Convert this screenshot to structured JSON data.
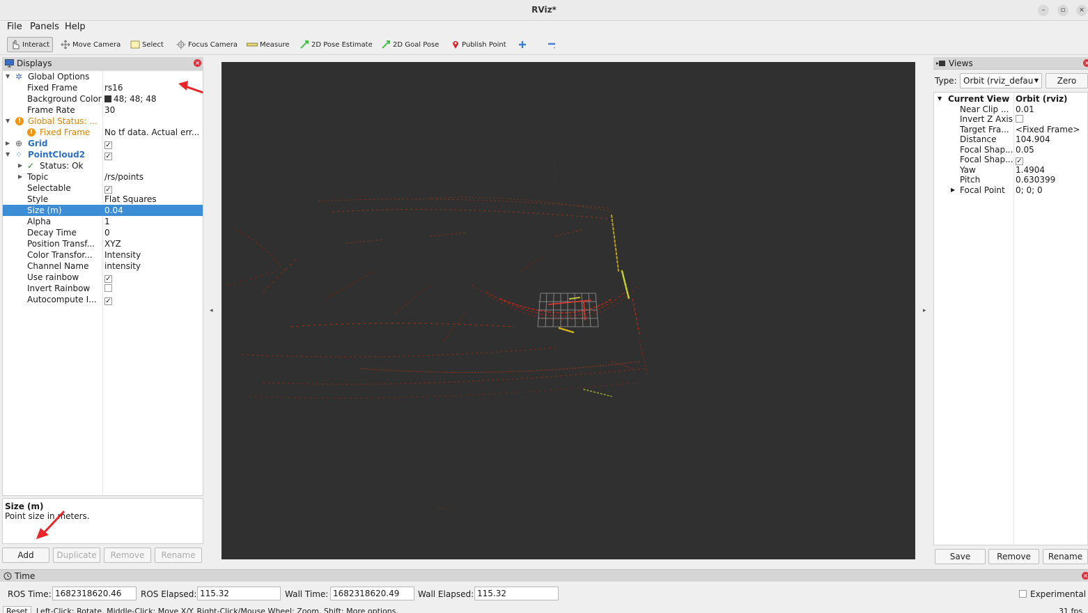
{
  "window": {
    "title": "RViz*"
  },
  "menu": [
    "File",
    "Panels",
    "Help"
  ],
  "toolbar": {
    "interact": "Interact",
    "move_camera": "Move Camera",
    "select": "Select",
    "focus_camera": "Focus Camera",
    "measure": "Measure",
    "pose_estimate": "2D Pose Estimate",
    "goal_pose": "2D Goal Pose",
    "publish_point": "Publish Point"
  },
  "displays": {
    "title": "Displays",
    "rows": [
      {
        "name": "Global Options",
        "value": ""
      },
      {
        "name": "Fixed Frame",
        "value": "rs16"
      },
      {
        "name": "Background Color",
        "value": "48; 48; 48"
      },
      {
        "name": "Frame Rate",
        "value": "30"
      },
      {
        "name": "Global Status: ...",
        "value": ""
      },
      {
        "name": "Fixed Frame",
        "value": "No tf data.  Actual err..."
      },
      {
        "name": "Grid",
        "value": ""
      },
      {
        "name": "PointCloud2",
        "value": ""
      },
      {
        "name": "Status: Ok",
        "value": ""
      },
      {
        "name": "Topic",
        "value": "/rs/points"
      },
      {
        "name": "Selectable",
        "value": ""
      },
      {
        "name": "Style",
        "value": "Flat Squares"
      },
      {
        "name": "Size (m)",
        "value": "0.04"
      },
      {
        "name": "Alpha",
        "value": "1"
      },
      {
        "name": "Decay Time",
        "value": "0"
      },
      {
        "name": "Position Transf...",
        "value": "XYZ"
      },
      {
        "name": "Color Transfor...",
        "value": "Intensity"
      },
      {
        "name": "Channel Name",
        "value": "intensity"
      },
      {
        "name": "Use rainbow",
        "value": ""
      },
      {
        "name": "Invert Rainbow",
        "value": ""
      },
      {
        "name": "Autocompute I...",
        "value": ""
      }
    ],
    "description": {
      "title": "Size (m)",
      "text": "Point size in meters."
    },
    "buttons": {
      "add": "Add",
      "duplicate": "Duplicate",
      "remove": "Remove",
      "rename": "Rename"
    }
  },
  "views": {
    "title": "Views",
    "type_label": "Type:",
    "type_value": "Orbit (rviz_defau",
    "zero": "Zero",
    "rows": [
      {
        "name": "Current View",
        "value": "Orbit (rviz)"
      },
      {
        "name": "Near Clip ...",
        "value": "0.01"
      },
      {
        "name": "Invert Z Axis",
        "value": ""
      },
      {
        "name": "Target Fra...",
        "value": "<Fixed Frame>"
      },
      {
        "name": "Distance",
        "value": "104.904"
      },
      {
        "name": "Focal Shap...",
        "value": "0.05"
      },
      {
        "name": "Focal Shap...",
        "value": ""
      },
      {
        "name": "Yaw",
        "value": "1.4904"
      },
      {
        "name": "Pitch",
        "value": "0.630399"
      },
      {
        "name": "Focal Point",
        "value": "0; 0; 0"
      }
    ],
    "buttons": {
      "save": "Save",
      "remove": "Remove",
      "rename": "Rename"
    }
  },
  "time": {
    "title": "Time",
    "ros_time_label": "ROS Time:",
    "ros_time": "1682318620.46",
    "ros_elapsed_label": "ROS Elapsed:",
    "ros_elapsed": "115.32",
    "wall_time_label": "Wall Time:",
    "wall_time": "1682318620.49",
    "wall_elapsed_label": "Wall Elapsed:",
    "wall_elapsed": "115.32",
    "experimental": "Experimental"
  },
  "status": {
    "reset": "Reset",
    "hint": "Left-Click: Rotate.  Middle-Click: Move X/Y.  Right-Click/Mouse Wheel: Zoom.  Shift: More options.",
    "fps": "31 fps"
  }
}
